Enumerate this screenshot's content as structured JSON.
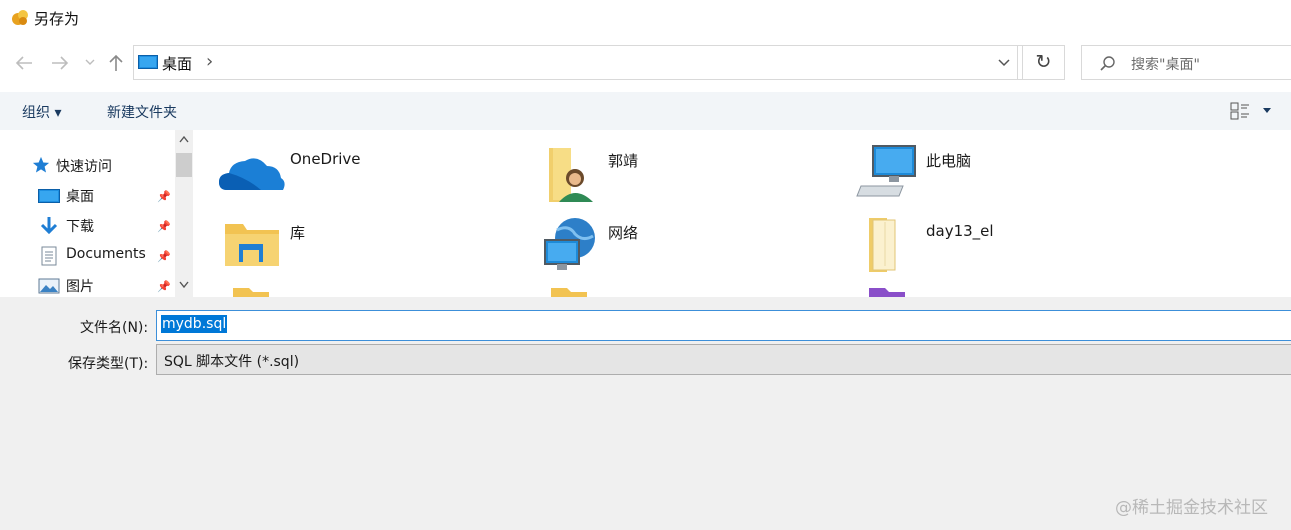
{
  "window": {
    "title": "另存为"
  },
  "nav": {
    "back_icon": "arrow-left-icon",
    "forward_icon": "arrow-right-icon",
    "recent_icon": "chevron-down-icon",
    "up_icon": "arrow-up-icon"
  },
  "address": {
    "path": "桌面",
    "separator": "›"
  },
  "search": {
    "placeholder": "搜索\"桌面\""
  },
  "toolbar": {
    "organize_label": "组织 ▾",
    "new_folder_label": "新建文件夹"
  },
  "sidebar": {
    "items": [
      {
        "label": "快速访问",
        "icon": "star-icon"
      },
      {
        "label": "桌面",
        "icon": "desktop-icon",
        "pinned": true
      },
      {
        "label": "下载",
        "icon": "download-icon",
        "pinned": true
      },
      {
        "label": "Documents",
        "icon": "document-icon",
        "pinned": true
      },
      {
        "label": "图片",
        "icon": "picture-icon",
        "pinned": true
      }
    ]
  },
  "files": {
    "items": [
      {
        "name": "OneDrive",
        "icon": "onedrive-icon"
      },
      {
        "name": "郭靖",
        "icon": "user-folder-icon"
      },
      {
        "name": "此电脑",
        "icon": "computer-icon"
      },
      {
        "name": "库",
        "icon": "library-icon"
      },
      {
        "name": "网络",
        "icon": "network-icon"
      },
      {
        "name": "day13_el",
        "icon": "folder-icon"
      }
    ]
  },
  "form": {
    "filename_label": "文件名(N):",
    "filename_value": "mydb.sql",
    "filetype_label": "保存类型(T):",
    "filetype_value": "SQL 脚本文件 (*.sql)"
  },
  "watermark": "@稀土掘金技术社区",
  "colors": {
    "selection": "#0078d7",
    "toolbar_bg": "#f2f5f8",
    "panel_bg": "#f0f0f0",
    "link": "#1a3a60"
  }
}
